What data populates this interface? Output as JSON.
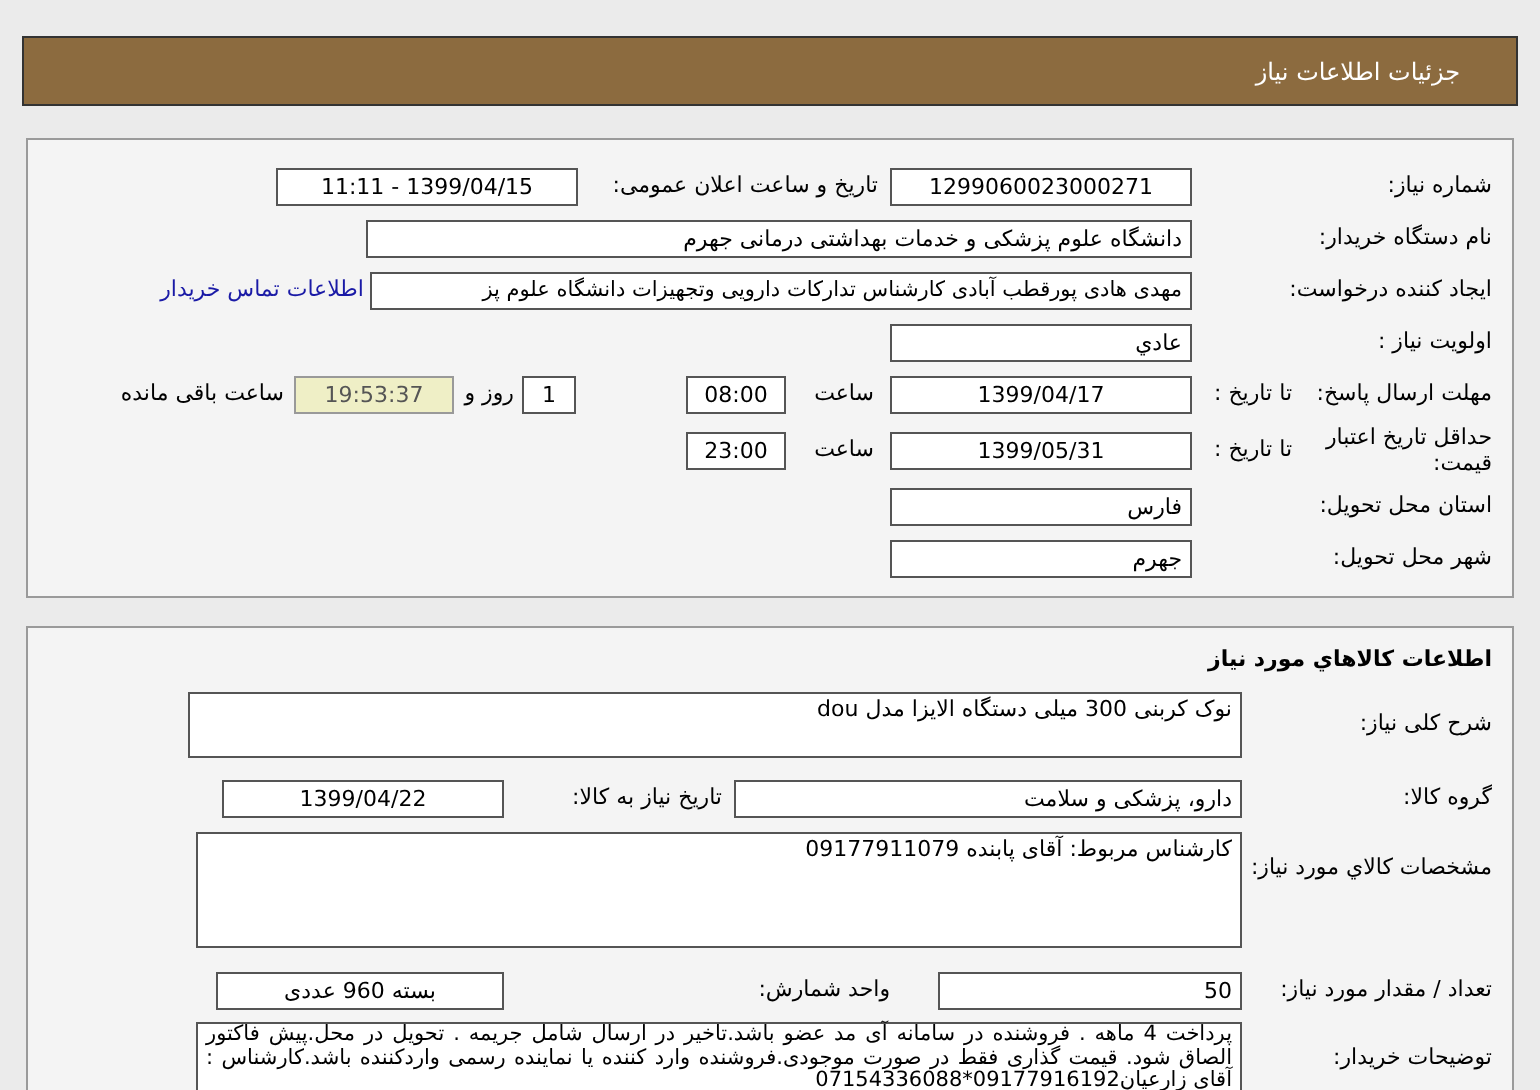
{
  "header": {
    "title": "جزئیات اطلاعات نیاز"
  },
  "need_info": {
    "need_number": {
      "label": "شماره نیاز:",
      "value": "1299060023000271"
    },
    "announce": {
      "label": "تاریخ و ساعت اعلان عمومی:",
      "value": "1399/04/15 - 11:11"
    },
    "buyer": {
      "label": "نام دستگاه خریدار:",
      "value": "دانشگاه علوم پزشکی و خدمات بهداشتی درمانی جهرم"
    },
    "requester": {
      "label": "ایجاد کننده درخواست:",
      "value": "مهدی هادی پورقطب آبادی کارشناس تدارکات دارویی وتجهیزات دانشگاه علوم پز",
      "link": "اطلاعات تماس خریدار"
    },
    "priority": {
      "label": "اولویت نیاز :",
      "value": "عادي"
    },
    "deadline": {
      "label": "مهلت ارسال پاسخ:",
      "to_date_label": "تا تاریخ :",
      "date": "1399/04/17",
      "time_label": "ساعت",
      "time": "08:00",
      "days": "1",
      "days_label": "روز و",
      "remaining": "19:53:37",
      "remaining_label": "ساعت باقی مانده"
    },
    "validity": {
      "label": "حداقل تاریخ اعتبار قیمت:",
      "to_date_label": "تا تاریخ :",
      "date": "1399/05/31",
      "time_label": "ساعت",
      "time": "23:00"
    },
    "province": {
      "label": "استان محل تحویل:",
      "value": "فارس"
    },
    "city": {
      "label": "شهر محل تحویل:",
      "value": "جهرم"
    }
  },
  "goods": {
    "title": "اطلاعات کالاهاي مورد نیاز",
    "description": {
      "label": "شرح کلی نیاز:",
      "value": "نوک کربنی 300 میلی دستگاه الایزا مدل dou"
    },
    "group": {
      "label": "گروه کالا:",
      "value": "دارو، پزشکی و سلامت",
      "need_date_label": "تاریخ نیاز به کالا:",
      "need_date": "1399/04/22"
    },
    "specs": {
      "label": "مشخصات کالاي مورد نیاز:",
      "value": "کارشناس مربوط: آقای پابنده 09177911079"
    },
    "quantity": {
      "label": "تعداد / مقدار مورد نیاز:",
      "value": "50",
      "unit_label": "واحد شمارش:",
      "unit": "بسته 960 عددی"
    },
    "notes": {
      "label": "توضیحات خریدار:",
      "value": "پرداخت 4 ماهه . فروشنده در سامانه آی مد عضو باشد.تاخیر در ارسال شامل جریمه . تحویل در محل.پیش فاکتور الصاق شود. قیمت گذاری فقط در صورت موجودی.فروشنده وارد کننده یا نماینده رسمی واردکننده باشد.کارشناس : آقای زارعیان09177916192*07154336088"
    }
  }
}
